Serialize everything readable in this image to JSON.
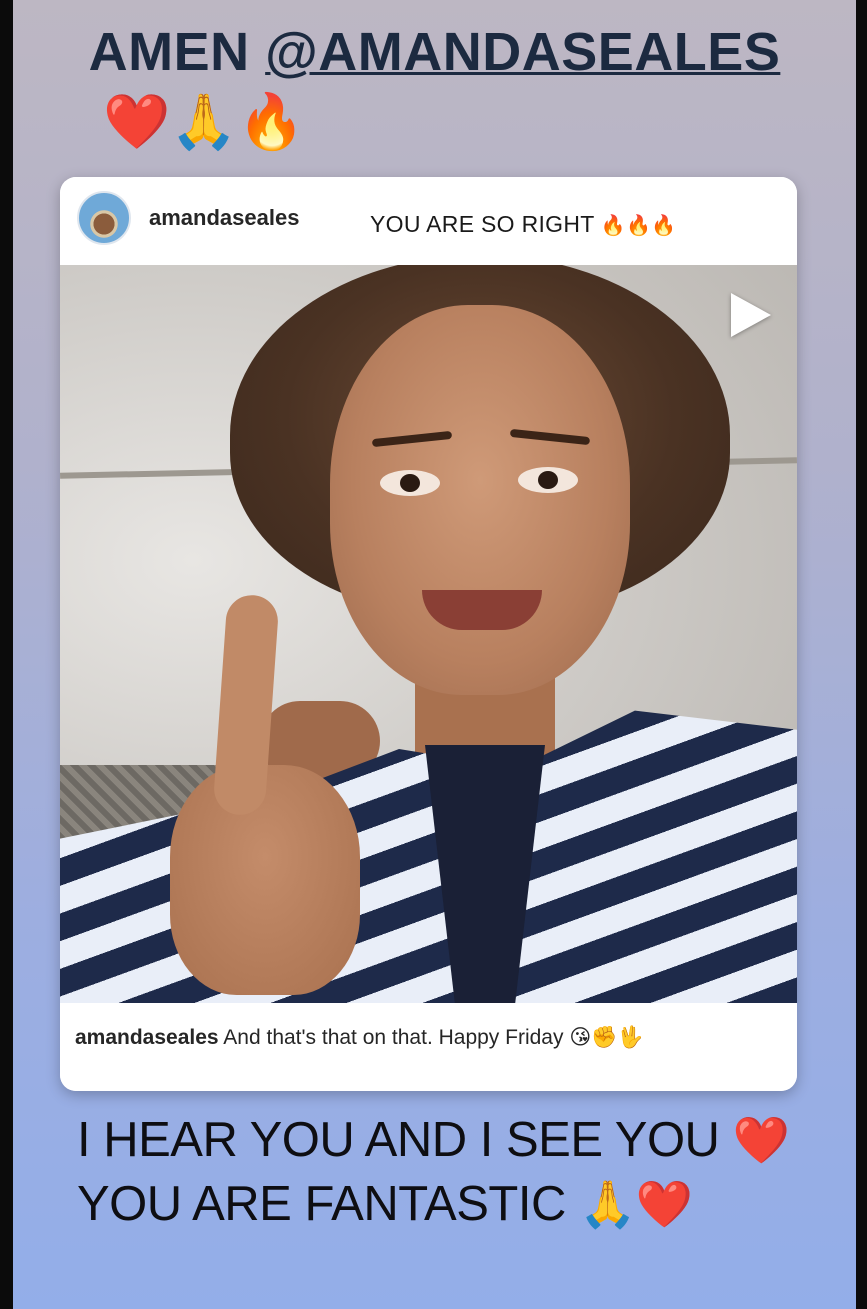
{
  "story": {
    "top_caption_prefix": "AMEN ",
    "top_caption_mention": "@AMANDASEALES",
    "top_emojis": "❤️🙏🔥"
  },
  "shared_post": {
    "username": "amandaseales",
    "header_caption": "YOU ARE SO RIGHT ",
    "header_caption_emojis": "🔥🔥🔥",
    "media_type_icon": "play-icon",
    "caption_username": "amandaseales",
    "caption_text": " And that's that on that. Happy Friday ",
    "caption_emojis": "😘✊🖖"
  },
  "bottom_caption": {
    "line1": "I HEAR YOU AND I SEE YOU ",
    "line1_emoji": "❤️",
    "line2": "YOU ARE FANTASTIC ",
    "line2_emoji": "🙏❤️"
  },
  "colors": {
    "background_top": "#bdb7c3",
    "background_bottom": "#93aee9",
    "top_text": "#1c2a40",
    "bottom_text": "#0e0e12"
  }
}
